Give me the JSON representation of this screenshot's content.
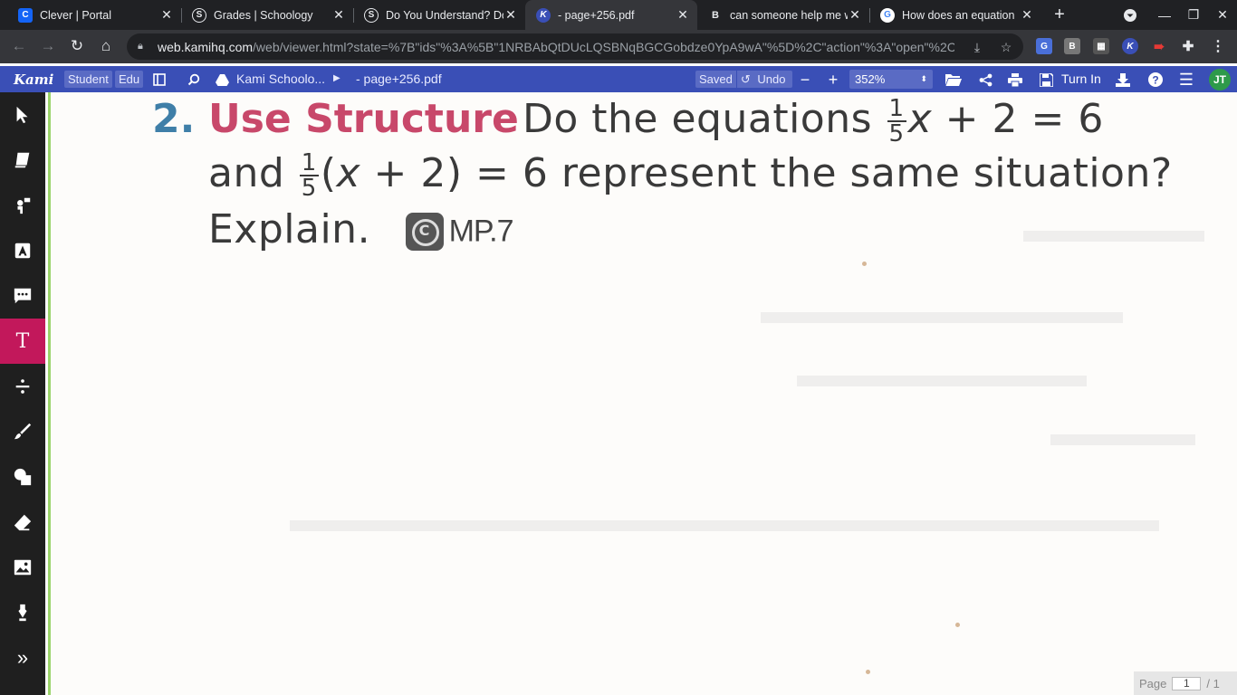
{
  "browser": {
    "tabs": [
      {
        "title": "Clever | Portal",
        "favicon": "C",
        "favicon_color": "#1464f6",
        "active": false
      },
      {
        "title": "Grades | Schoology",
        "favicon": "S",
        "favicon_color": "#202124",
        "active": false
      },
      {
        "title": "Do You Understand? Do",
        "favicon": "S",
        "favicon_color": "#202124",
        "active": false
      },
      {
        "title": "- page+256.pdf",
        "favicon": "K",
        "favicon_color": "#3a4fb6",
        "active": true
      },
      {
        "title": "can someone help me w",
        "favicon": "B",
        "favicon_color": "#202124",
        "active": false
      },
      {
        "title": "How does an equation",
        "favicon": "G",
        "favicon_color": "#ffffff",
        "active": false
      }
    ],
    "url_host": "web.kamihq.com",
    "url_path": "/web/viewer.html?state=%7B\"ids\"%3A%5B\"1NRBAbQtDUcLQSBNqBGCGobdze0YpA9wA\"%5D%2C\"action\"%3A\"open\"%2C\"us..."
  },
  "kami": {
    "logo": "Kami",
    "role_badge": "Student",
    "plan_badge": "Edu",
    "drive_folder": "Kami Schoolo...",
    "file_name": "- page+256.pdf",
    "saved_label": "Saved",
    "undo_label": "Undo",
    "zoom": "352%",
    "turn_in_label": "Turn In",
    "user_initials": "JT",
    "accent": "#3a4fb6"
  },
  "text_tool": {
    "font_size": "14",
    "colors": [
      "#000000",
      "#e01010",
      "#ffffff"
    ],
    "selected_color": "#000000"
  },
  "document": {
    "question_number": "2.",
    "strategy": "Use Structure",
    "line1_lead": "Do the equations",
    "frac_num": "1",
    "frac_den": "5",
    "line1_var": "x",
    "line1_tail": "+ 2 = 6",
    "line2_lead": "and",
    "line2_open": "(",
    "line2_var": "x",
    "line2_tail": "+ 2) = 6 represent the same situation?",
    "line3_text": "Explain.",
    "practice_code": "MP.7"
  },
  "pager": {
    "label": "Page",
    "current": "1",
    "total": "/ 1"
  }
}
